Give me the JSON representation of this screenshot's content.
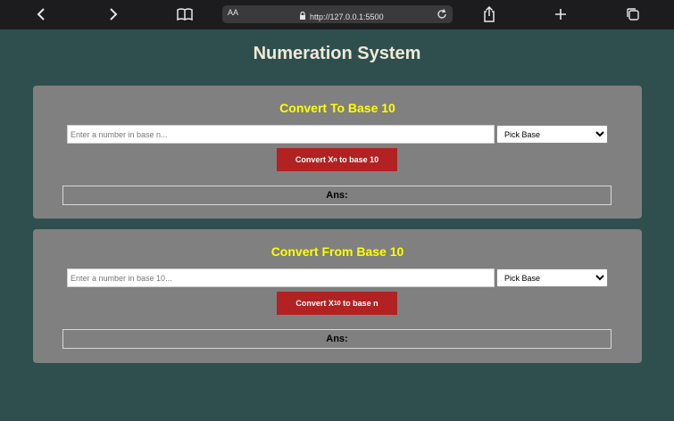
{
  "browser": {
    "text_size_label": "AA",
    "url": "http://127.0.0.1:5500",
    "icons": [
      "back-icon",
      "forward-icon",
      "bookmarks-icon",
      "lock-icon",
      "reload-icon",
      "share-icon",
      "new-tab-icon",
      "tabs-icon"
    ]
  },
  "page": {
    "title": "Numeration System"
  },
  "to_base10": {
    "title": "Convert To Base 10",
    "input_placeholder": "Enter a number in base n...",
    "select_value": "Pick Base",
    "button_prefix": "Convert X",
    "button_sub": "n",
    "button_suffix": " to base 10",
    "ans_label": "Ans:"
  },
  "from_base10": {
    "title": "Convert From Base 10",
    "input_placeholder": "Enter a number in base 10...",
    "select_value": "Pick Base",
    "button_prefix": "Convert X",
    "button_sub": "10",
    "button_suffix": " to base n",
    "ans_label": "Ans:"
  },
  "colors": {
    "page_bg": "#2f4f4f",
    "card_bg": "#808080",
    "card_title": "#ffff00",
    "button_bg": "#b22222",
    "toolbar_bg": "#1c1c1e"
  }
}
